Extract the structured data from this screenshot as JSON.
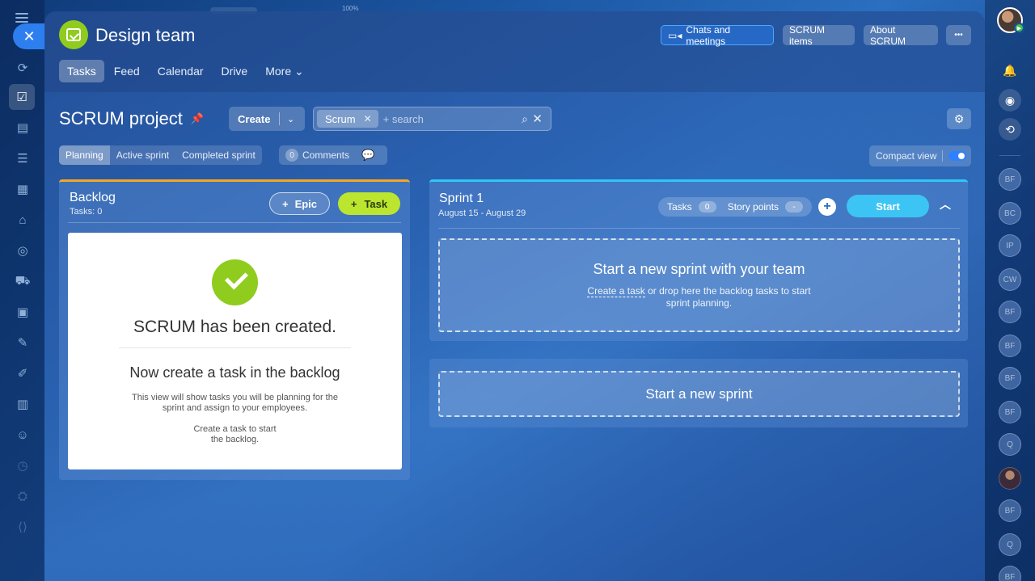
{
  "topbar": {
    "zoom": "100%"
  },
  "window": {
    "title": "Design team"
  },
  "header": {
    "chats_label": "Chats and meetings",
    "scrum_items_label": "SCRUM items",
    "about_label": "About SCRUM",
    "more_dots": "•••"
  },
  "nav": [
    {
      "label": "Tasks",
      "active": true
    },
    {
      "label": "Feed"
    },
    {
      "label": "Calendar"
    },
    {
      "label": "Drive"
    },
    {
      "label": "More ⌄"
    }
  ],
  "project": {
    "title": "SCRUM project",
    "create_label": "Create",
    "search_chip": "Scrum",
    "search_placeholder": "+ search"
  },
  "tabs": [
    {
      "label": "Planning",
      "active": true
    },
    {
      "label": "Active sprint"
    },
    {
      "label": "Completed sprint"
    }
  ],
  "comments": {
    "count": "0",
    "label": "Comments"
  },
  "compact_view": {
    "label": "Compact view",
    "enabled": true
  },
  "backlog": {
    "title": "Backlog",
    "subtitle": "Tasks: 0",
    "epic_label": "Epic",
    "task_label": "Task",
    "card": {
      "heading": "SCRUM has been created.",
      "subheading": "Now create a task in the backlog",
      "text1_line1": "This view will show tasks you will be planning for the",
      "text1_line2": "sprint and assign to your employees.",
      "text2_line1": "Create a task to start",
      "text2_line2": "the backlog."
    }
  },
  "sprint": {
    "title": "Sprint 1",
    "dates": "August 15 - August 29",
    "tasks_label": "Tasks",
    "tasks_count": "0",
    "points_label": "Story points",
    "points_value": "-",
    "start_label": "Start",
    "drop_heading": "Start a new sprint with your team",
    "drop_link": "Create a task",
    "drop_text1": " or drop here the backlog tasks to start",
    "drop_text2": "sprint planning."
  },
  "new_sprint": {
    "label": "Start a new sprint"
  },
  "right_rail_users": [
    "BF",
    "BC",
    "IP",
    "CW",
    "BF",
    "BF",
    "BF",
    "BF",
    "Q",
    "",
    "BF",
    "Q",
    "BF"
  ],
  "colors": {
    "accent_green": "#8fcc1d",
    "task_button": "#bbe52e",
    "start_button": "#3cc4f5",
    "backlog_border": "#f5a623",
    "sprint_border": "#2fc6f6"
  }
}
